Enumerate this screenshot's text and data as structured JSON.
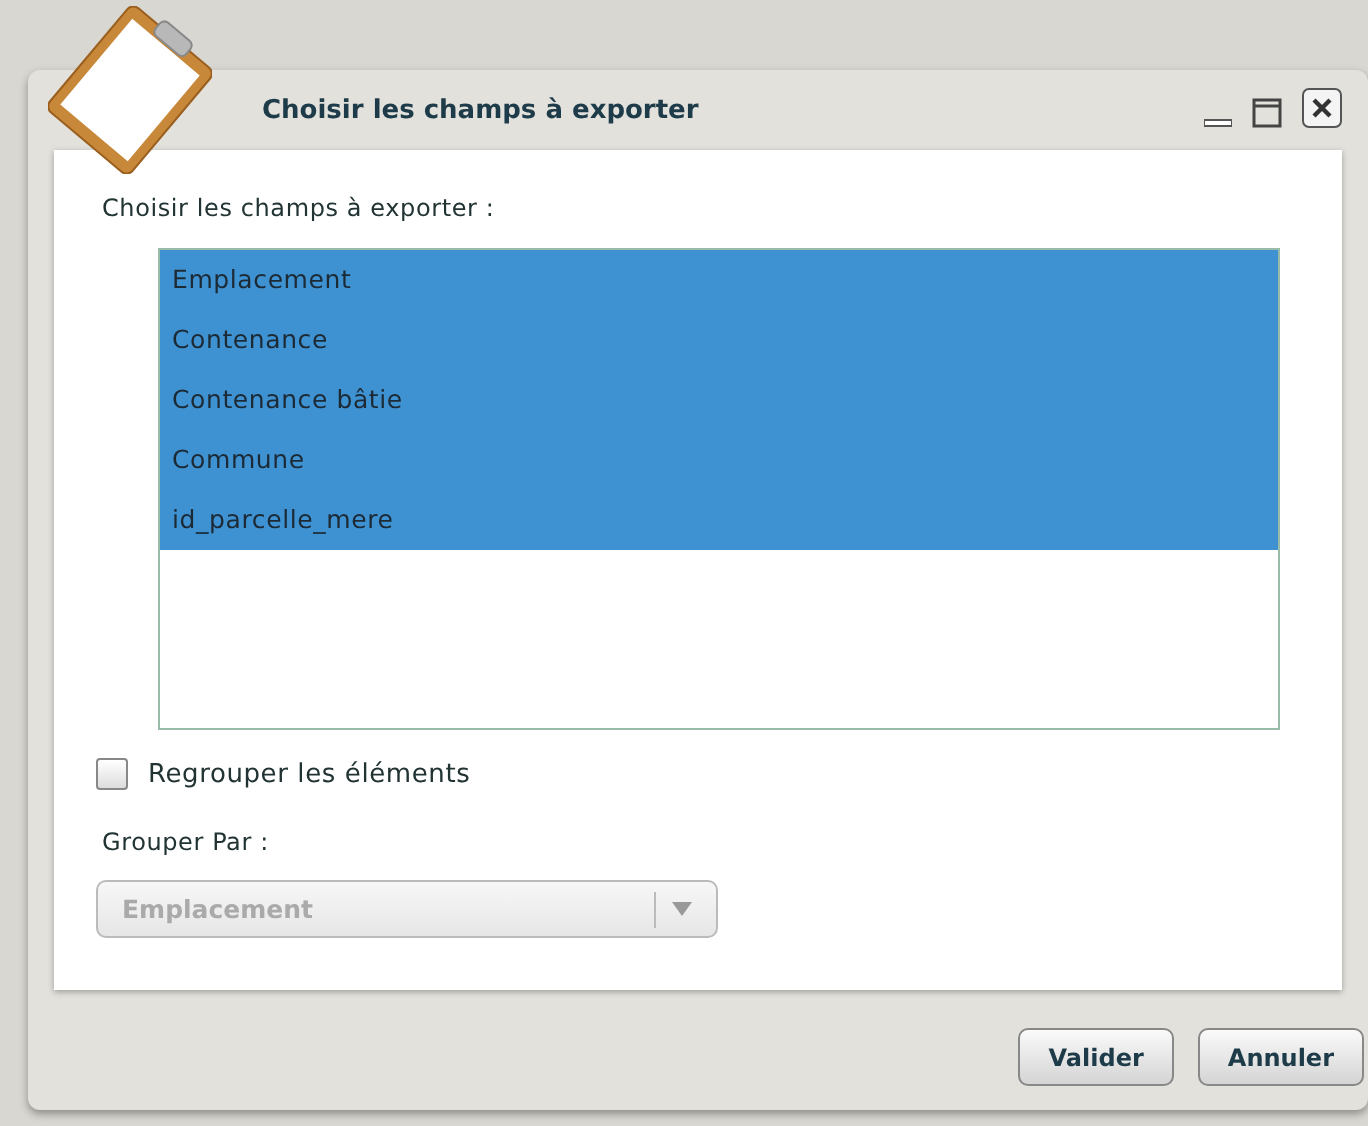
{
  "window": {
    "title": "Choisir les champs à exporter"
  },
  "fields_label": "Choisir les champs à exporter :",
  "fields": [
    {
      "label": "Emplacement",
      "selected": true
    },
    {
      "label": "Contenance",
      "selected": true
    },
    {
      "label": "Contenance bâtie",
      "selected": true
    },
    {
      "label": "Commune",
      "selected": true
    },
    {
      "label": "id_parcelle_mere",
      "selected": true
    }
  ],
  "group_checkbox": {
    "label": "Regrouper les éléments",
    "checked": false
  },
  "group_by": {
    "label": "Grouper Par :",
    "value": "Emplacement",
    "disabled": true
  },
  "buttons": [
    "Valider",
    "Annuler"
  ]
}
